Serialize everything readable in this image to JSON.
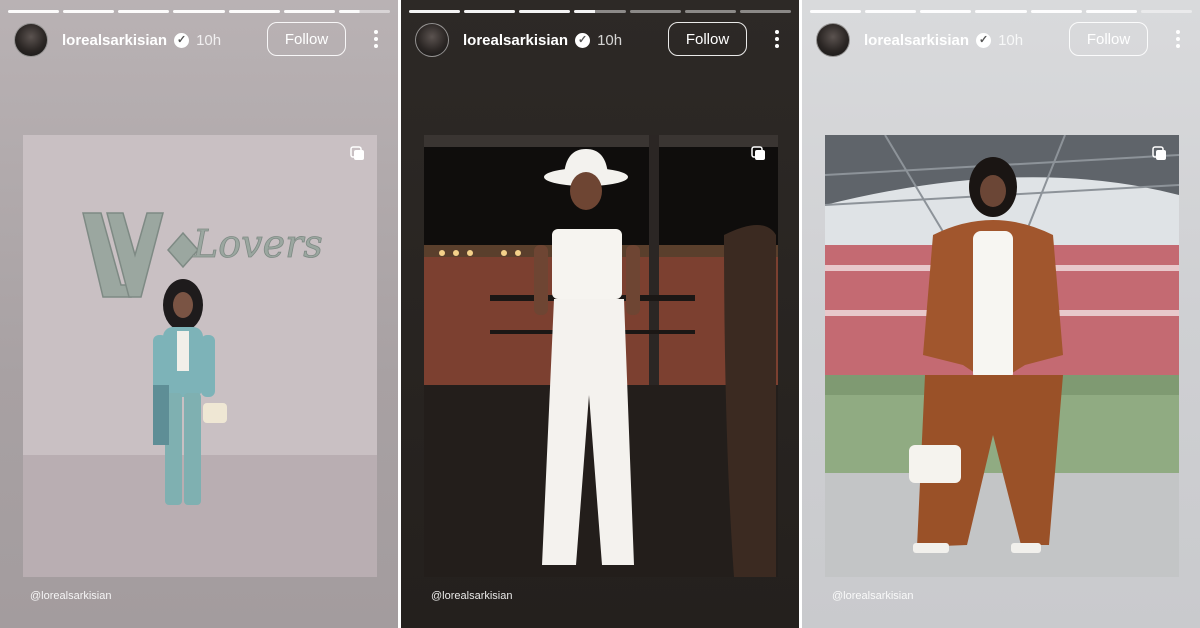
{
  "stories": [
    {
      "username": "lorealsarkisian",
      "time": "10h",
      "follow_label": "Follow",
      "caption": "@lorealsarkisian",
      "photo_sign_text": "Lovers"
    },
    {
      "username": "lorealsarkisian",
      "time": "10h",
      "follow_label": "Follow",
      "caption": "@lorealsarkisian"
    },
    {
      "username": "lorealsarkisian",
      "time": "10h",
      "follow_label": "Follow",
      "caption": "@lorealsarkisian"
    }
  ],
  "icons": {
    "verified": "verified-badge-icon",
    "more": "more-options-icon",
    "multi_photo": "multiple-photos-icon"
  },
  "colors": {
    "accent_white": "#ffffff"
  }
}
